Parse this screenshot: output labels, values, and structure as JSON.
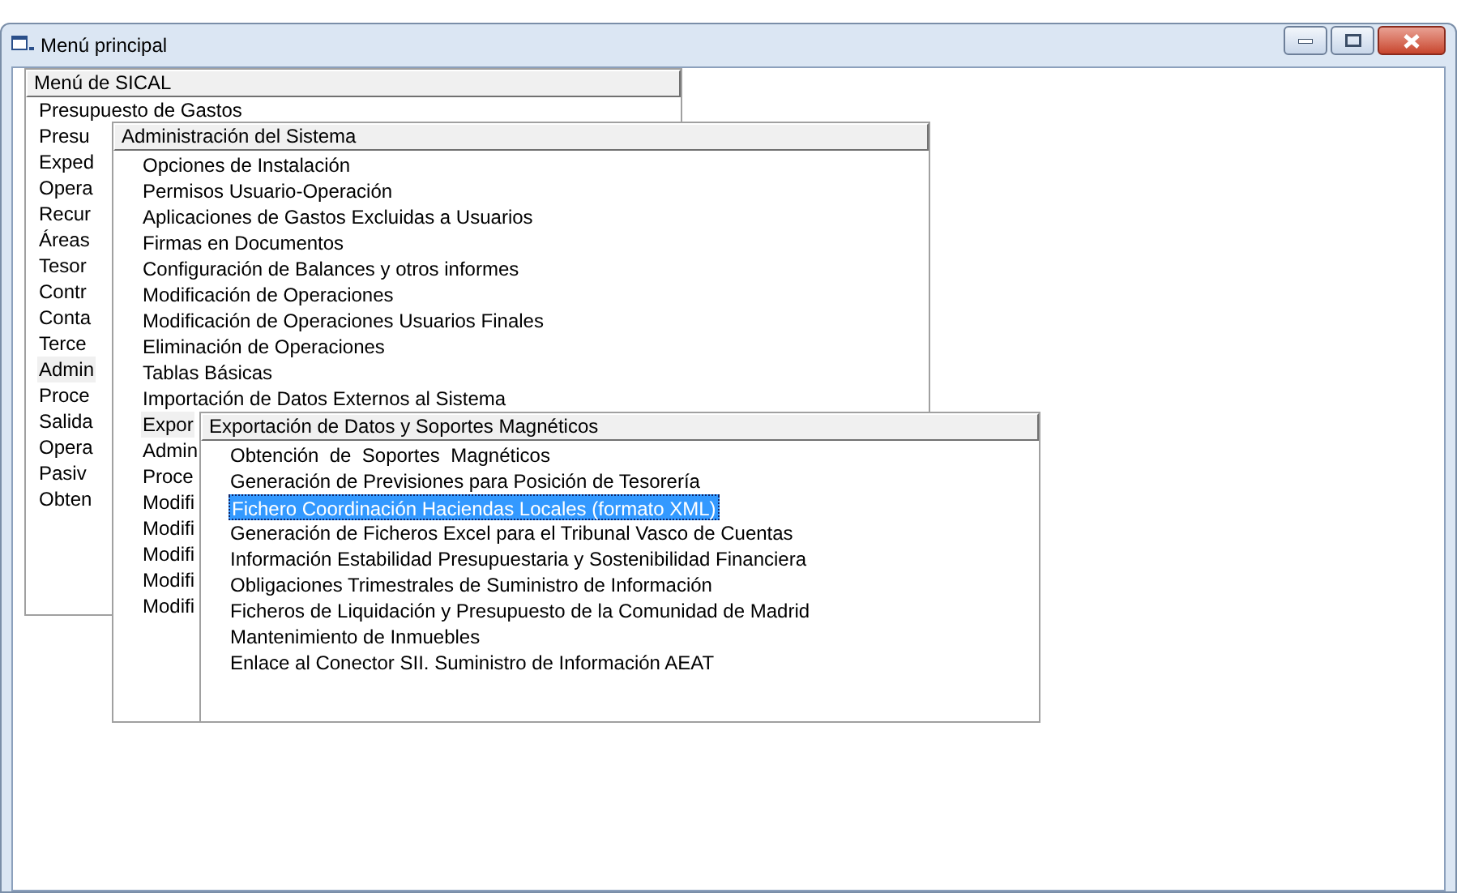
{
  "window": {
    "title": "Menú principal"
  },
  "menus": [
    {
      "title": "Menú de SICAL",
      "focused": false,
      "items": [
        {
          "label": "Presupuesto de Gastos",
          "selected": false
        },
        {
          "label": "Presu",
          "selected": false
        },
        {
          "label": "Exped",
          "selected": false
        },
        {
          "label": "Opera",
          "selected": false
        },
        {
          "label": "Recur",
          "selected": false
        },
        {
          "label": "Áreas",
          "selected": false
        },
        {
          "label": "Tesor",
          "selected": false
        },
        {
          "label": "Contr",
          "selected": false
        },
        {
          "label": "Conta",
          "selected": false
        },
        {
          "label": "Terce",
          "selected": false
        },
        {
          "label": "Admin",
          "selected": true
        },
        {
          "label": "Proce",
          "selected": false
        },
        {
          "label": "Salida",
          "selected": false
        },
        {
          "label": "Opera",
          "selected": false
        },
        {
          "label": "Pasiv",
          "selected": false
        },
        {
          "label": "Obten",
          "selected": false
        }
      ]
    },
    {
      "title": "Administración del Sistema",
      "focused": false,
      "items": [
        {
          "label": "Opciones de Instalación",
          "selected": false
        },
        {
          "label": "Permisos Usuario-Operación",
          "selected": false
        },
        {
          "label": "Aplicaciones de Gastos Excluidas a Usuarios",
          "selected": false
        },
        {
          "label": "Firmas en Documentos",
          "selected": false
        },
        {
          "label": "Configuración de Balances y otros informes",
          "selected": false
        },
        {
          "label": "Modificación de Operaciones",
          "selected": false
        },
        {
          "label": "Modificación de Operaciones Usuarios Finales",
          "selected": false
        },
        {
          "label": "Eliminación de Operaciones",
          "selected": false
        },
        {
          "label": "Tablas Básicas",
          "selected": false
        },
        {
          "label": "Importación de Datos Externos al Sistema",
          "selected": false
        },
        {
          "label": "Expor",
          "selected": true
        },
        {
          "label": "Admin",
          "selected": false
        },
        {
          "label": "Proce",
          "selected": false
        },
        {
          "label": "Modifi",
          "selected": false
        },
        {
          "label": "Modifi",
          "selected": false
        },
        {
          "label": "Modifi",
          "selected": false
        },
        {
          "label": "Modifi",
          "selected": false
        },
        {
          "label": "Modifi",
          "selected": false
        }
      ]
    },
    {
      "title": "Exportación de Datos y Soportes Magnéticos",
      "focused": true,
      "items": [
        {
          "label": "Obtención  de  Soportes  Magnéticos",
          "selected": false
        },
        {
          "label": "Generación de Previsiones para Posición de Tesorería",
          "selected": false
        },
        {
          "label": "Fichero Coordinación Haciendas Locales (formato XML)",
          "selected": true
        },
        {
          "label": "Generación de Ficheros Excel para el Tribunal Vasco de Cuentas",
          "selected": false
        },
        {
          "label": "Información Estabilidad Presupuestaria y Sostenibilidad Financiera",
          "selected": false
        },
        {
          "label": "Obligaciones Trimestrales de Suministro de Información",
          "selected": false
        },
        {
          "label": "Ficheros de Liquidación y Presupuesto de la Comunidad de Madrid",
          "selected": false
        },
        {
          "label": "Mantenimiento de Inmuebles",
          "selected": false
        },
        {
          "label": "Enlace al Conector SII. Suministro de Información AEAT",
          "selected": false
        }
      ]
    }
  ]
}
